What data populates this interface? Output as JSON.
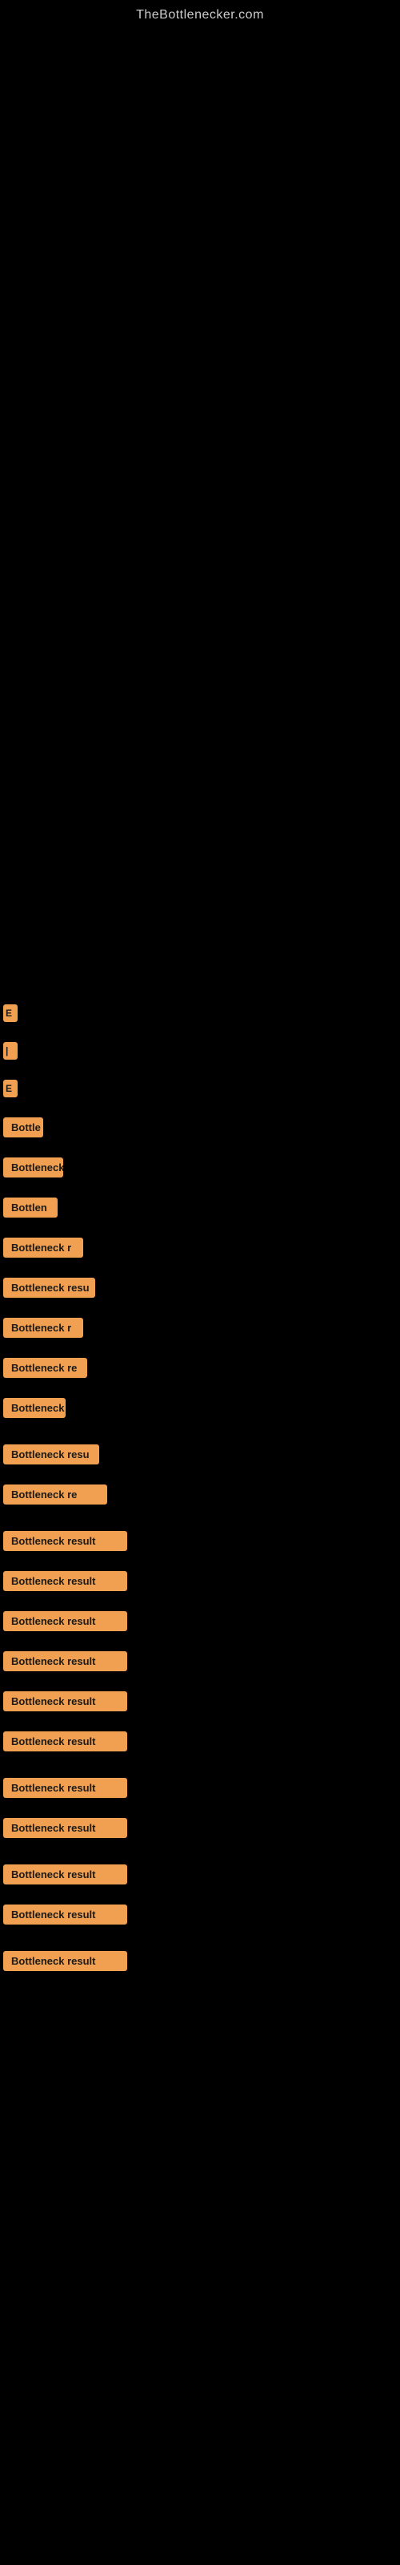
{
  "site": {
    "title": "TheBottlenecker.com"
  },
  "results": [
    {
      "id": 1,
      "label": "E",
      "class": "small-label",
      "text": "E"
    },
    {
      "id": 2,
      "label": "|",
      "class": "small-label medium-label-1",
      "text": "|"
    },
    {
      "id": 3,
      "label": "E",
      "class": "small-label medium-label-2",
      "text": "E"
    },
    {
      "id": 4,
      "label": "Bottle",
      "class": "bottleneck-tiny",
      "text": "Bottle"
    },
    {
      "id": 5,
      "label": "Bottleneck",
      "class": "bottleneck-small",
      "text": "Bottleneck"
    },
    {
      "id": 6,
      "label": "Bottlen",
      "class": "bottleneck-small2",
      "text": "Bottlen"
    },
    {
      "id": 7,
      "label": "Bottleneck r",
      "class": "bottleneck-medium1",
      "text": "Bottleneck r"
    },
    {
      "id": 8,
      "label": "Bottleneck resu",
      "class": "bottleneck-medium2",
      "text": "Bottleneck resu"
    },
    {
      "id": 9,
      "label": "Bottleneck r",
      "class": "bottleneck-medium3",
      "text": "Bottleneck r"
    },
    {
      "id": 10,
      "label": "Bottleneck re",
      "class": "bottleneck-medium4",
      "text": "Bottleneck re"
    },
    {
      "id": 11,
      "label": "Bottleneck",
      "class": "bottleneck-medium5",
      "text": "Bottleneck"
    },
    {
      "id": 12,
      "label": "Bottleneck resu",
      "class": "bottleneck-large1",
      "text": "Bottleneck resu"
    },
    {
      "id": 13,
      "label": "Bottleneck re",
      "class": "bottleneck-large2",
      "text": "Bottleneck re"
    },
    {
      "id": 14,
      "label": "Bottleneck result",
      "class": "bottleneck-full1",
      "text": "Bottleneck result"
    },
    {
      "id": 15,
      "label": "Bottleneck result",
      "class": "bottleneck-full2",
      "text": "Bottleneck result"
    },
    {
      "id": 16,
      "label": "Bottleneck result",
      "class": "bottleneck-full3",
      "text": "Bottleneck result"
    },
    {
      "id": 17,
      "label": "Bottleneck result",
      "class": "bottleneck-full4",
      "text": "Bottleneck result"
    },
    {
      "id": 18,
      "label": "Bottleneck result",
      "class": "bottleneck-full5",
      "text": "Bottleneck result"
    },
    {
      "id": 19,
      "label": "Bottleneck result",
      "class": "bottleneck-full6",
      "text": "Bottleneck result"
    },
    {
      "id": 20,
      "label": "Bottleneck result",
      "class": "bottleneck-full7",
      "text": "Bottleneck result"
    },
    {
      "id": 21,
      "label": "Bottleneck result",
      "class": "bottleneck-full8",
      "text": "Bottleneck result"
    },
    {
      "id": 22,
      "label": "Bottleneck result",
      "class": "bottleneck-full9",
      "text": "Bottleneck result"
    },
    {
      "id": 23,
      "label": "Bottleneck result",
      "class": "bottleneck-full10",
      "text": "Bottleneck result"
    },
    {
      "id": 24,
      "label": "Bottleneck result",
      "class": "bottleneck-full11",
      "text": "Bottleneck result"
    }
  ]
}
